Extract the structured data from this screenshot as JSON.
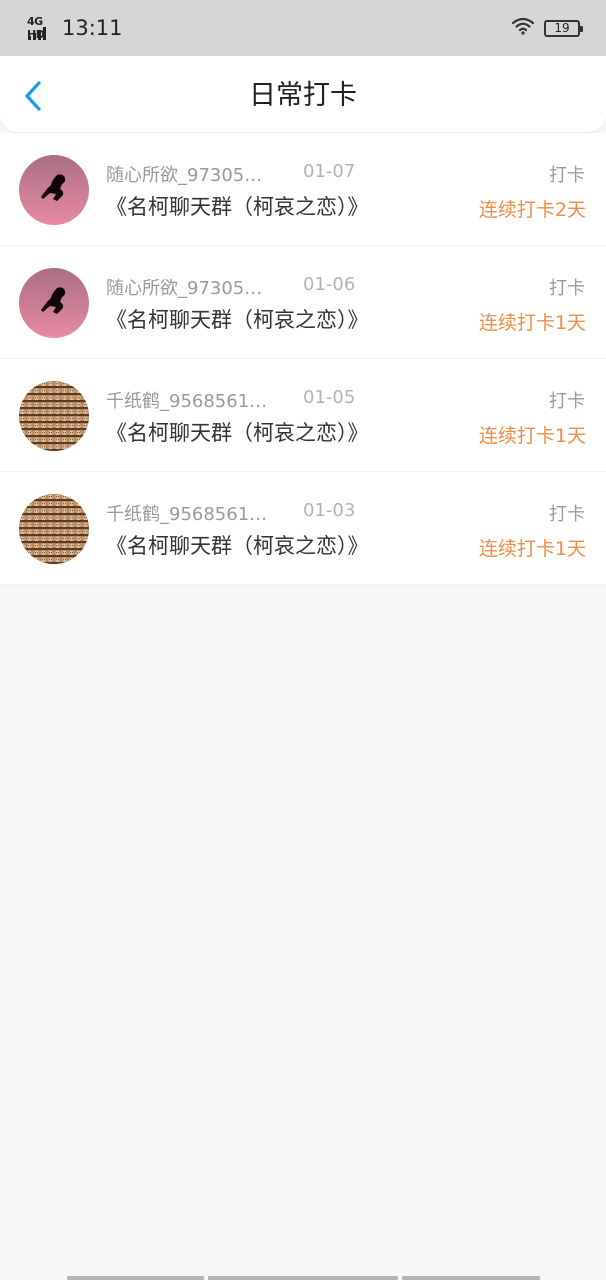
{
  "status_bar": {
    "network": "4G HD",
    "time": "13:11",
    "battery": "19"
  },
  "header": {
    "title": "日常打卡",
    "back_icon": "chevron-left-icon",
    "accent_color": "#1a9be6"
  },
  "checkins": [
    {
      "username": "随心所欲_97305…",
      "date": "01-07",
      "title": "《名柯聊天群（柯哀之恋）》",
      "type": "打卡",
      "streak": "连续打卡2天",
      "avatar": "pink-silhouette-avatar"
    },
    {
      "username": "随心所欲_97305…",
      "date": "01-06",
      "title": "《名柯聊天群（柯哀之恋）》",
      "type": "打卡",
      "streak": "连续打卡1天",
      "avatar": "pink-silhouette-avatar"
    },
    {
      "username": "千纸鹤_9568561…",
      "date": "01-05",
      "title": "《名柯聊天群（柯哀之恋）》",
      "type": "打卡",
      "streak": "连续打卡1天",
      "avatar": "mosaic-faces-avatar"
    },
    {
      "username": "千纸鹤_9568561…",
      "date": "01-03",
      "title": "《名柯聊天群（柯哀之恋）》",
      "type": "打卡",
      "streak": "连续打卡1天",
      "avatar": "mosaic-faces-avatar"
    }
  ],
  "colors": {
    "streak": "#f08d47",
    "background": "#f8f7f8"
  }
}
